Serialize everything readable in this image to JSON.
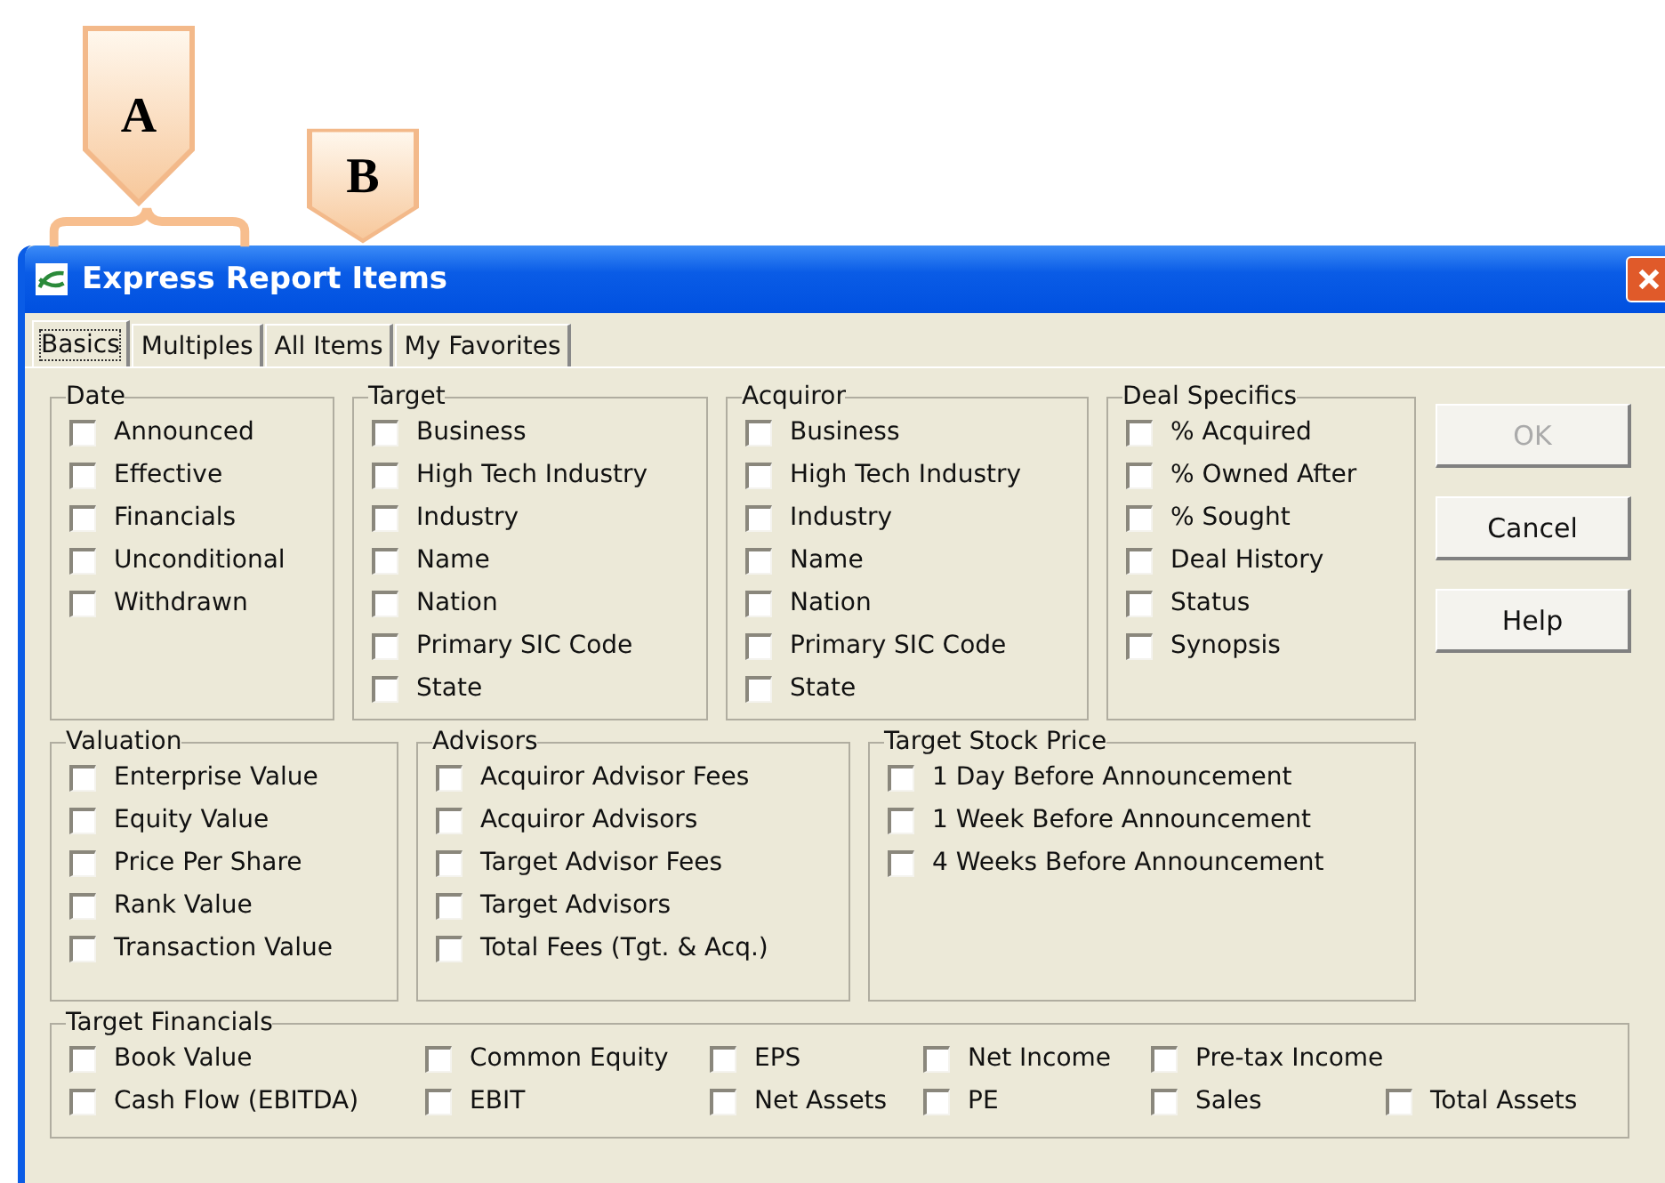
{
  "callouts": [
    {
      "label": "A"
    },
    {
      "label": "B"
    }
  ],
  "window": {
    "title": "Express Report Items"
  },
  "tabs": [
    {
      "label": "Basics",
      "selected": true
    },
    {
      "label": "Multiples",
      "selected": false
    },
    {
      "label": "All Items",
      "selected": false
    },
    {
      "label": "My Favorites",
      "selected": false
    }
  ],
  "groups_top": [
    {
      "title": "Date",
      "items": [
        {
          "label": "Announced",
          "checked": false
        },
        {
          "label": "Effective",
          "checked": false
        },
        {
          "label": "Financials",
          "checked": false
        },
        {
          "label": "Unconditional",
          "checked": false
        },
        {
          "label": "Withdrawn",
          "checked": false
        }
      ]
    },
    {
      "title": "Target",
      "items": [
        {
          "label": "Business",
          "checked": false
        },
        {
          "label": "High Tech Industry",
          "checked": false
        },
        {
          "label": "Industry",
          "checked": false
        },
        {
          "label": "Name",
          "checked": false
        },
        {
          "label": "Nation",
          "checked": false
        },
        {
          "label": "Primary SIC Code",
          "checked": false
        },
        {
          "label": "State",
          "checked": false
        }
      ]
    },
    {
      "title": "Acquiror",
      "items": [
        {
          "label": "Business",
          "checked": false
        },
        {
          "label": "High Tech Industry",
          "checked": false
        },
        {
          "label": "Industry",
          "checked": false
        },
        {
          "label": "Name",
          "checked": false
        },
        {
          "label": "Nation",
          "checked": false
        },
        {
          "label": "Primary SIC Code",
          "checked": false
        },
        {
          "label": "State",
          "checked": false
        }
      ]
    },
    {
      "title": "Deal Specifics",
      "items": [
        {
          "label": "% Acquired",
          "checked": false
        },
        {
          "label": "% Owned After",
          "checked": false
        },
        {
          "label": "% Sought",
          "checked": false
        },
        {
          "label": "Deal History",
          "checked": false
        },
        {
          "label": "Status",
          "checked": false
        },
        {
          "label": "Synopsis",
          "checked": false
        }
      ]
    }
  ],
  "buttons": [
    {
      "label": "OK",
      "disabled": true
    },
    {
      "label": "Cancel",
      "disabled": false
    },
    {
      "label": "Help",
      "disabled": false
    }
  ],
  "groups_middle": [
    {
      "title": "Valuation",
      "items": [
        {
          "label": "Enterprise Value",
          "checked": false
        },
        {
          "label": "Equity Value",
          "checked": false
        },
        {
          "label": "Price Per Share",
          "checked": false
        },
        {
          "label": "Rank Value",
          "checked": false
        },
        {
          "label": "Transaction Value",
          "checked": false
        }
      ]
    },
    {
      "title": "Advisors",
      "items": [
        {
          "label": "Acquiror Advisor Fees",
          "checked": false
        },
        {
          "label": "Acquiror Advisors",
          "checked": false
        },
        {
          "label": "Target Advisor Fees",
          "checked": false
        },
        {
          "label": "Target Advisors",
          "checked": false
        },
        {
          "label": "Total Fees (Tgt. & Acq.)",
          "checked": false
        }
      ]
    },
    {
      "title": "Target Stock Price",
      "items": [
        {
          "label": "1 Day Before Announcement",
          "checked": false
        },
        {
          "label": "1 Week Before Announcement",
          "checked": false
        },
        {
          "label": "4 Weeks Before Announcement",
          "checked": false
        }
      ]
    }
  ],
  "target_financials": {
    "title": "Target Financials",
    "rows": [
      [
        {
          "label": "Book Value",
          "checked": false
        },
        {
          "label": "Common Equity",
          "checked": false
        },
        {
          "label": "EPS",
          "checked": false
        },
        {
          "label": "Net Income",
          "checked": false
        },
        {
          "label": "Pre-tax Income",
          "checked": false
        }
      ],
      [
        {
          "label": "Cash Flow (EBITDA)",
          "checked": false
        },
        {
          "label": "EBIT",
          "checked": false
        },
        {
          "label": "Net Assets",
          "checked": false
        },
        {
          "label": "PE",
          "checked": false
        },
        {
          "label": "Sales",
          "checked": false
        },
        {
          "label": "Total Assets",
          "checked": false
        }
      ]
    ]
  }
}
